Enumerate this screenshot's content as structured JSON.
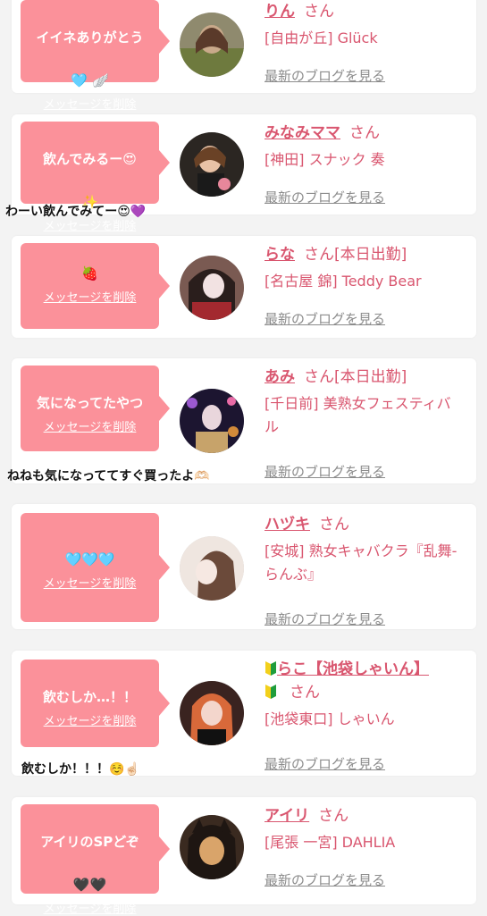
{
  "delete_label": "メッセージを削除",
  "san_label": "さん",
  "blog_label": "最新のブログを見る",
  "colors": {
    "bubble": "#fb919a",
    "accent": "#d9566f",
    "muted": "#8c8c8c"
  },
  "cards": [
    {
      "message": "イイネありがとう",
      "message_emoji": "🩵 🪽",
      "name": "りん",
      "status": "",
      "shop": "[自由が丘] Glück",
      "comment": ""
    },
    {
      "message": "飲んでみるー😍",
      "message_emoji": "✨",
      "name": "みなみママ",
      "status": "",
      "shop": "[神田] スナック 奏",
      "comment": "わーい飲んでみてー😍💜"
    },
    {
      "message": "🍓",
      "message_emoji": "",
      "name": "らな",
      "status": "[本日出勤]",
      "shop": "[名古屋 錦] Teddy Bear",
      "comment": ""
    },
    {
      "message": "気になってたやつ",
      "message_emoji": "",
      "name": "あみ",
      "status": "[本日出勤]",
      "shop": "[千日前] 美熟女フェスティバル",
      "comment": "ねねも気になっててすぐ買ったよ🫶🏻"
    },
    {
      "message": "🩵🩵🩵",
      "message_emoji": "",
      "name": "ハヅキ",
      "status": "",
      "shop": "[安城] 熟女キャバクラ『乱舞-らんぶ』",
      "comment": ""
    },
    {
      "message": "飲むしか…！！",
      "message_emoji": "",
      "name": "らこ【池袋しゃいん】",
      "status": "",
      "shop": "[池袋東口] しゃいん",
      "comment": "飲むしか！！！☺️☝🏻"
    },
    {
      "message": "アイリのSPどぞ",
      "message_emoji": "🖤🖤",
      "name": "アイリ",
      "status": "",
      "shop": "[尾張 一宮] DAHLIA",
      "comment": ""
    }
  ]
}
